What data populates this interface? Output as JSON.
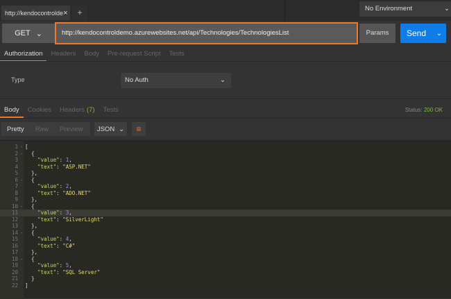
{
  "tab": {
    "title": "http://kendocontrolde",
    "close": "×",
    "new_tab": "+"
  },
  "environment": {
    "label": "No Environment",
    "chevron": "⌄"
  },
  "request": {
    "method": "GET",
    "url": "http://kendocontroldemo.azurewebsites.net/api/Technologies/TechnologiesList",
    "params_label": "Params",
    "send_label": "Send"
  },
  "request_tabs": [
    {
      "label": "Authorization",
      "active": true
    },
    {
      "label": "Headers"
    },
    {
      "label": "Body"
    },
    {
      "label": "Pre-request Script"
    },
    {
      "label": "Tests"
    }
  ],
  "auth": {
    "type_label": "Type",
    "value": "No Auth"
  },
  "response_tabs": [
    {
      "label": "Body",
      "active": true
    },
    {
      "label": "Cookies"
    },
    {
      "label": "Headers",
      "badge": "(7)"
    },
    {
      "label": "Tests"
    }
  ],
  "status": {
    "label": "Status:",
    "value": "200 OK"
  },
  "view_modes": [
    {
      "label": "Pretty",
      "active": true
    },
    {
      "label": "Raw"
    },
    {
      "label": "Preview"
    }
  ],
  "format": {
    "value": "JSON"
  },
  "colors": {
    "accent": "#f0792a",
    "send": "#0f7ce8",
    "status_ok": "#7dbc3a"
  },
  "code_lines": [
    "[",
    "  {",
    "    \"value\": 1,",
    "    \"text\": \"ASP.NET\"",
    "  },",
    "  {",
    "    \"value\": 2,",
    "    \"text\": \"ADO.NET\"",
    "  },",
    "  {",
    "    \"value\": 3,",
    "    \"text\": \"SilverLight\"",
    "  },",
    "  {",
    "    \"value\": 4,",
    "    \"text\": \"C#\"",
    "  },",
    "  {",
    "    \"value\": 5,",
    "    \"text\": \"SQL Server\"",
    "  }",
    "]"
  ],
  "fold_lines": [
    1,
    2,
    6,
    10,
    14,
    18
  ],
  "highlight_line": 11
}
